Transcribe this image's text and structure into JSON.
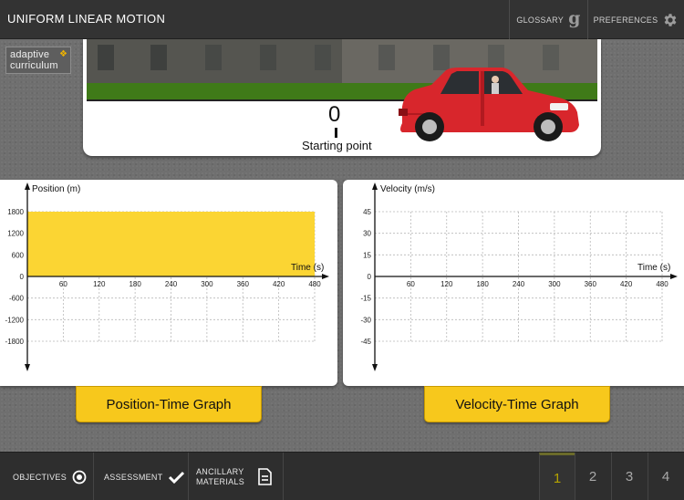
{
  "header": {
    "title": "UNIFORM LINEAR MOTION",
    "glossary_label": "GLOSSARY",
    "preferences_label": "PREFERENCES"
  },
  "logo": {
    "line1": "adaptive",
    "line2": "curriculum"
  },
  "scene": {
    "position_readout": "0",
    "start_label": "Starting point"
  },
  "position_graph": {
    "ylabel": "Position (m)",
    "xlabel": "Time (s)",
    "x_ticks": [
      "60",
      "120",
      "180",
      "240",
      "300",
      "360",
      "420",
      "480"
    ],
    "y_ticks": [
      "1800",
      "1200",
      "600",
      "0",
      "-600",
      "-1200",
      "-1800"
    ],
    "button_label": "Position-Time Graph"
  },
  "velocity_graph": {
    "ylabel": "Velocity (m/s)",
    "xlabel": "Time (s)",
    "x_ticks": [
      "60",
      "120",
      "180",
      "240",
      "300",
      "360",
      "420",
      "480"
    ],
    "y_ticks": [
      "45",
      "30",
      "15",
      "0",
      "-15",
      "-30",
      "-45"
    ],
    "button_label": "Velocity-Time Graph"
  },
  "chart_data": [
    {
      "type": "area",
      "ylabel": "Position (m)",
      "xlabel": "Time (s)",
      "xlim": [
        0,
        480
      ],
      "ylim": [
        -1800,
        1800
      ],
      "grid": true,
      "series": [
        {
          "x": [
            0,
            480
          ],
          "values": [
            1800,
            1800
          ],
          "color": "#fbd533"
        }
      ]
    },
    {
      "type": "line",
      "ylabel": "Velocity (m/s)",
      "xlabel": "Time (s)",
      "xlim": [
        0,
        480
      ],
      "ylim": [
        -45,
        45
      ],
      "grid": true,
      "series": []
    }
  ],
  "footer": {
    "objectives_label": "OBJECTIVES",
    "assessment_label": "ASSESSMENT",
    "ancillary_label": "ANCILLARY MATERIALS",
    "pages": [
      "1",
      "2",
      "3",
      "4"
    ],
    "active_page": "1"
  },
  "colors": {
    "accent_yellow": "#f7c81c",
    "area_fill": "#fbd533",
    "topbar": "#333333",
    "car_red": "#d8262c"
  }
}
